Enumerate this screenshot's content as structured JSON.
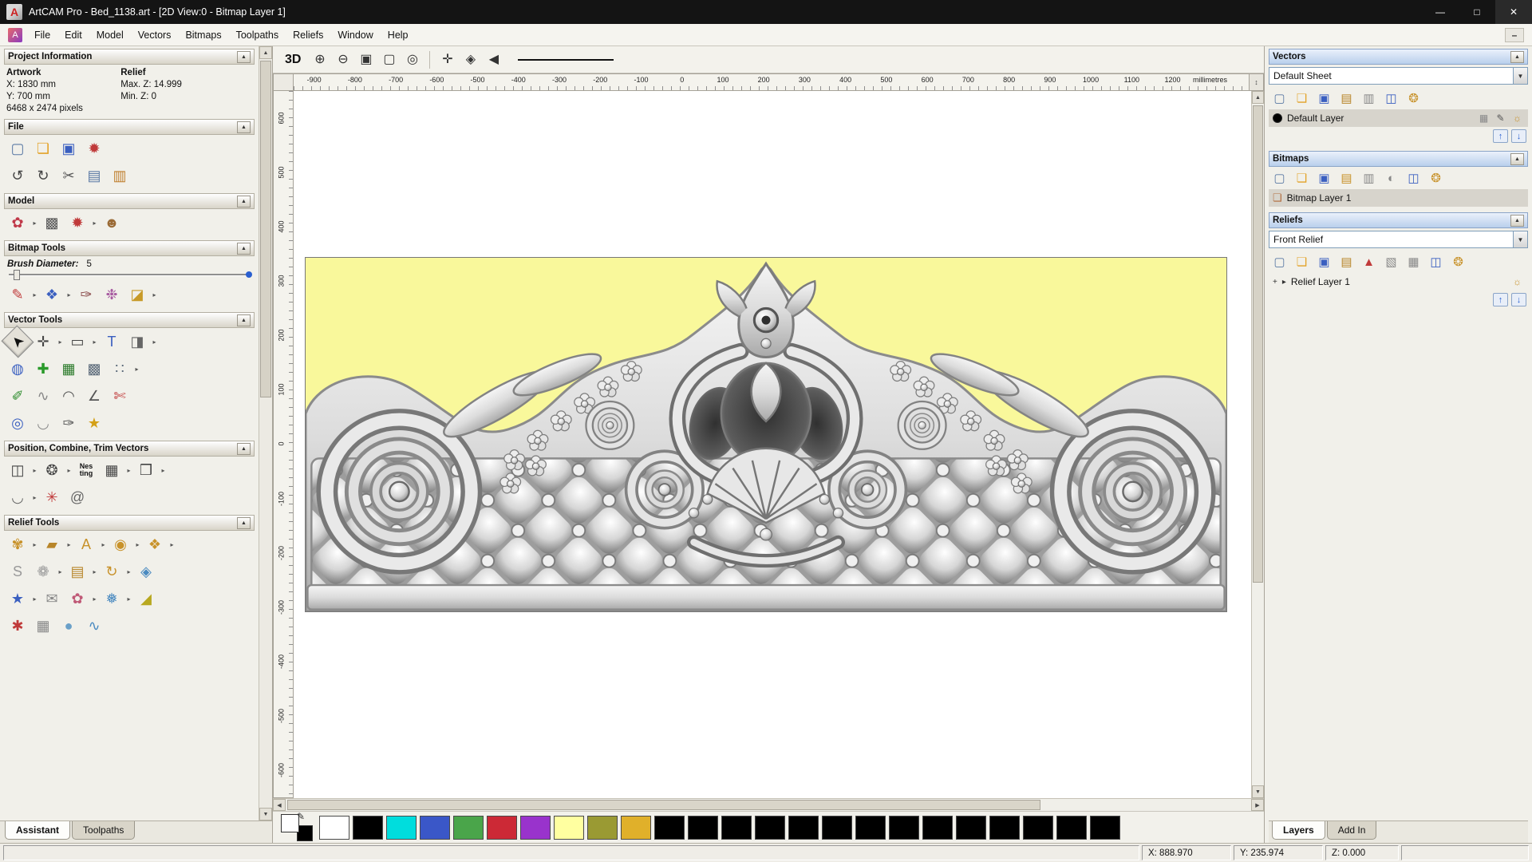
{
  "window": {
    "title": "ArtCAM Pro - Bed_1138.art - [2D View:0 - Bitmap Layer 1]",
    "logo_glyph": "A",
    "controls": {
      "minimize": "—",
      "maximize": "□",
      "close": "✕"
    }
  },
  "menu": {
    "items": [
      "File",
      "Edit",
      "Model",
      "Vectors",
      "Bitmaps",
      "Toolpaths",
      "Reliefs",
      "Window",
      "Help"
    ],
    "mdi_minimize": "–"
  },
  "ui": {
    "collapse": "▲",
    "dropdown": "▼",
    "arrow": "▸",
    "expander": "▸",
    "plus": "+",
    "up": "↑",
    "down": "↓",
    "scroll_up": "▲",
    "scroll_down": "▼",
    "scroll_left": "◀",
    "scroll_right": "▶",
    "resize": "↕",
    "pencil": "✎"
  },
  "left_panel": {
    "project_info": {
      "title": "Project Information",
      "artwork_label": "Artwork",
      "relief_label": "Relief",
      "x": "X: 1830 mm",
      "y": "Y: 700 mm",
      "pixels": "6468 x 2474 pixels",
      "max_z": "Max. Z: 14.999",
      "min_z": "Min. Z: 0"
    },
    "file": {
      "title": "File",
      "rows": [
        [
          {
            "n": "new-model-icon",
            "g": "▢",
            "c": "#5b7aa5"
          },
          {
            "n": "open-model-icon",
            "g": "❏",
            "c": "#e3a32a"
          },
          {
            "n": "save-model-icon",
            "g": "▣",
            "c": "#3a5fc0"
          },
          {
            "n": "model-notes-icon",
            "g": "✹",
            "c": "#c03a3a"
          }
        ],
        [
          {
            "n": "undo-icon",
            "g": "↺",
            "c": "#444444"
          },
          {
            "n": "redo-icon",
            "g": "↻",
            "c": "#444444"
          },
          {
            "n": "cut-icon",
            "g": "✂",
            "c": "#555555"
          },
          {
            "n": "copy-icon",
            "g": "▤",
            "c": "#5b7aa5"
          },
          {
            "n": "paste-icon",
            "g": "▥",
            "c": "#c08030"
          }
        ]
      ]
    },
    "model": {
      "title": "Model",
      "rows": [
        [
          {
            "n": "relief-wizard-icon",
            "g": "✿",
            "c": "#c03a4a",
            "a": true
          },
          {
            "n": "greyscale-icon",
            "g": "▩",
            "c": "#555555"
          },
          {
            "n": "lighting-icon",
            "g": "✹",
            "c": "#c03a3a",
            "a": true
          },
          {
            "n": "face-wizard-icon",
            "g": "☻",
            "c": "#9a6a35"
          }
        ]
      ]
    },
    "bitmap_tools": {
      "title": "Bitmap Tools",
      "brush_label": "Brush Diameter:",
      "brush_value": "5",
      "rows": [
        [
          {
            "n": "paint-brush-icon",
            "g": "✎",
            "c": "#c03a3a",
            "a": true
          },
          {
            "n": "paint-selective-icon",
            "g": "❖",
            "c": "#3a5fc0",
            "a": true
          },
          {
            "n": "colour-picker-icon",
            "g": "✑",
            "c": "#8a4a4a"
          },
          {
            "n": "palette-icon",
            "g": "❉",
            "c": "#a75aa0"
          },
          {
            "n": "flood-fill-icon",
            "g": "◪",
            "c": "#c89a28",
            "a": true
          }
        ]
      ]
    },
    "vector_tools": {
      "title": "Vector Tools",
      "rows": [
        [
          {
            "n": "select-vectors-icon",
            "g": "➤",
            "c": "#111111",
            "rot": -135,
            "p": true
          },
          {
            "n": "transform-vectors-icon",
            "g": "✛",
            "c": "#444444",
            "a": true
          },
          {
            "n": "create-rectangle-icon",
            "g": "▭",
            "c": "#444444",
            "a": true
          },
          {
            "n": "create-text-icon",
            "g": "T",
            "c": "#3a5fc0"
          },
          {
            "n": "mirror-vectors-icon",
            "g": "◨",
            "c": "#666666",
            "a": true
          }
        ],
        [
          {
            "n": "offset-vectors-icon",
            "g": "◍",
            "c": "#3a5fc0"
          },
          {
            "n": "vector-doctor-icon",
            "g": "✚",
            "c": "#2a9a2a"
          },
          {
            "n": "text-in-box-icon",
            "g": "▦",
            "c": "#2a7a2a"
          },
          {
            "n": "bitmap-to-vector-icon",
            "g": "▩",
            "c": "#5b6a7a"
          },
          {
            "n": "paste-along-curve-icon",
            "g": "∷",
            "c": "#5b6a7a",
            "a": true
          }
        ],
        [
          {
            "n": "create-polyline-icon",
            "g": "✐",
            "c": "#2a8a2a"
          },
          {
            "n": "free-smooth-icon",
            "g": "∿",
            "c": "#888888"
          },
          {
            "n": "node-editing-icon",
            "g": "◠",
            "c": "#555555"
          },
          {
            "n": "measure-icon",
            "g": "∠",
            "c": "#555555"
          },
          {
            "n": "trim-vectors-icon",
            "g": "✄",
            "c": "#c03a3a"
          }
        ],
        [
          {
            "n": "join-vectors-icon",
            "g": "◎",
            "c": "#3a5fc0"
          },
          {
            "n": "fillet-arc-icon",
            "g": "◡",
            "c": "#888888"
          },
          {
            "n": "vector-pen-icon",
            "g": "✑",
            "c": "#555555"
          },
          {
            "n": "create-star-icon",
            "g": "★",
            "c": "#d4a017"
          }
        ]
      ]
    },
    "position_tools": {
      "title": "Position, Combine, Trim Vectors",
      "rows": [
        [
          {
            "n": "align-vectors-icon",
            "g": "◫",
            "c": "#444444",
            "a": true
          },
          {
            "n": "circular-copy-icon",
            "g": "❂",
            "c": "#444444",
            "a": true
          },
          {
            "n": "nesting-icon",
            "g": "Nes\nting",
            "c": "#111111"
          },
          {
            "n": "block-copy-icon",
            "g": "▦",
            "c": "#444444",
            "a": true
          },
          {
            "n": "group-vectors-icon",
            "g": "❒",
            "c": "#444444",
            "a": true
          }
        ],
        [
          {
            "n": "wrap-vectors-icon",
            "g": "◡",
            "c": "#666666",
            "a": true
          },
          {
            "n": "weld-vectors-icon",
            "g": "✳",
            "c": "#c03a3a"
          },
          {
            "n": "create-spiral-icon",
            "g": "@",
            "c": "#666666"
          }
        ]
      ]
    },
    "relief_tools": {
      "title": "Relief Tools",
      "rows": [
        [
          {
            "n": "sculpting-icon",
            "g": "✾",
            "c": "#c8922a",
            "a": true
          },
          {
            "n": "smooth-relief-icon",
            "g": "▰",
            "c": "#b8862a",
            "a": true
          },
          {
            "n": "relief-text-icon",
            "g": "A",
            "c": "#c8922a",
            "a": true
          },
          {
            "n": "shape-editor-icon",
            "g": "◉",
            "c": "#c8922a",
            "a": true
          },
          {
            "n": "extrude-relief-icon",
            "g": "❖",
            "c": "#c8922a",
            "a": true
          }
        ],
        [
          {
            "n": "two-rail-sweep-icon",
            "g": "S",
            "c": "#999999"
          },
          {
            "n": "weave-wizard-icon",
            "g": "❁",
            "c": "#999999",
            "a": true
          },
          {
            "n": "relief-library-icon",
            "g": "▤",
            "c": "#b8862a",
            "a": true
          },
          {
            "n": "spin-relief-icon",
            "g": "↻",
            "c": "#c8922a",
            "a": true
          },
          {
            "n": "constrain-relief-icon",
            "g": "◈",
            "c": "#4a8ac0"
          }
        ],
        [
          {
            "n": "star-relief-icon",
            "g": "★",
            "c": "#3a5fc0",
            "a": true
          },
          {
            "n": "relief-envelope-icon",
            "g": "✉",
            "c": "#888888"
          },
          {
            "n": "fan-relief-icon",
            "g": "✿",
            "c": "#c05a77",
            "a": true
          },
          {
            "n": "texture-relief-icon",
            "g": "❅",
            "c": "#4a8ac0",
            "a": true
          },
          {
            "n": "angled-plane-icon",
            "g": "◢",
            "c": "#b8a820"
          }
        ],
        [
          {
            "n": "offset-relief-icon",
            "g": "✱",
            "c": "#c03a3a"
          },
          {
            "n": "mesh-relief-icon",
            "g": "▦",
            "c": "#888888"
          },
          {
            "n": "dome-relief-icon",
            "g": "●",
            "c": "#6aa0c8"
          },
          {
            "n": "wave-relief-icon",
            "g": "∿",
            "c": "#4a8ac0"
          }
        ]
      ]
    },
    "tabs": [
      {
        "label": "Assistant",
        "active": true
      },
      {
        "label": "Toolpaths",
        "active": false
      }
    ]
  },
  "canvas": {
    "view_3d_label": "3D",
    "zoom_tools": [
      [
        {
          "n": "zoom-in-icon",
          "g": "⊕",
          "c": "#333333"
        },
        {
          "n": "zoom-out-icon",
          "g": "⊖",
          "c": "#333333"
        },
        {
          "n": "zoom-window-icon",
          "g": "▣",
          "c": "#333333"
        },
        {
          "n": "zoom-fit-icon",
          "g": "▢",
          "c": "#333333"
        },
        {
          "n": "zoom-objects-icon",
          "g": "◎",
          "c": "#333333"
        }
      ]
    ],
    "nav_tools": [
      [
        {
          "n": "pan-view-icon",
          "g": "✛",
          "c": "#333333"
        },
        {
          "n": "centre-view-icon",
          "g": "◈",
          "c": "#333333"
        },
        {
          "n": "previous-view-icon",
          "g": "◀",
          "c": "#333333"
        }
      ]
    ],
    "ruler_unit": "millimetres",
    "h_ticks": [
      "-900",
      "-800",
      "-700",
      "-600",
      "-500",
      "-400",
      "-300",
      "-200",
      "-100",
      "0",
      "100",
      "200",
      "300",
      "400",
      "500",
      "600",
      "700",
      "800",
      "900",
      "1000",
      "1100",
      "1200"
    ],
    "v_ticks": [
      "600",
      "500",
      "400",
      "300",
      "200",
      "100",
      "0",
      "-100",
      "-200",
      "-300",
      "-400",
      "-500",
      "-600"
    ],
    "artwork_bg": "#f9f89b"
  },
  "palette": {
    "selector": {
      "front": "#ffffff",
      "back": "#000000"
    },
    "swatches": [
      "#ffffff",
      "#000000",
      "#00dddd",
      "#3a57c8",
      "#4aa54a",
      "#cc2936",
      "#9933cc",
      "#ffffa0",
      "#9a9a33",
      "#e0b02a",
      "#000000",
      "#000000",
      "#000000",
      "#000000",
      "#000000",
      "#000000",
      "#000000",
      "#000000",
      "#000000",
      "#000000",
      "#000000",
      "#000000",
      "#000000",
      "#000000"
    ]
  },
  "right_panel": {
    "vectors": {
      "title": "Vectors",
      "sheet": "Default Sheet",
      "toolbar": [
        [
          {
            "n": "new-sheet-icon",
            "g": "▢",
            "c": "#5b7aa5"
          },
          {
            "n": "open-sheet-icon",
            "g": "❏",
            "c": "#e3a32a"
          },
          {
            "n": "save-sheet-icon",
            "g": "▣",
            "c": "#3a5fc0"
          },
          {
            "n": "import-vectors-icon",
            "g": "▤",
            "c": "#b8862a"
          },
          {
            "n": "export-vectors-icon",
            "g": "▥",
            "c": "#888888"
          },
          {
            "n": "delete-layer-icon",
            "g": "◫",
            "c": "#3a5fc0"
          },
          {
            "n": "layer-wizard-icon",
            "g": "❂",
            "c": "#c8922a"
          }
        ]
      ],
      "layer": {
        "name": "Default Layer",
        "swatch": "#000000",
        "icons": [
          [
            {
              "n": "layer-lock-icon",
              "g": "▦",
              "c": "#888888"
            },
            {
              "n": "layer-edit-icon",
              "g": "✎",
              "c": "#555555"
            },
            {
              "n": "layer-visible-icon",
              "g": "☼",
              "c": "#c8922a"
            }
          ]
        ]
      }
    },
    "bitmaps": {
      "title": "Bitmaps",
      "toolbar": [
        [
          {
            "n": "new-bitmap-layer-icon",
            "g": "▢",
            "c": "#5b7aa5"
          },
          {
            "n": "open-bitmap-layer-icon",
            "g": "❏",
            "c": "#e3a32a"
          },
          {
            "n": "save-bitmap-layer-icon",
            "g": "▣",
            "c": "#3a5fc0"
          },
          {
            "n": "copy-bitmap-layer-icon",
            "g": "▤",
            "c": "#c8922a"
          },
          {
            "n": "merge-bitmap-layers-icon",
            "g": "▥",
            "c": "#888888"
          },
          {
            "n": "preview-bitmap-icon",
            "g": "◐",
            "c": "#888888"
          },
          {
            "n": "delete-bitmap-layer-icon",
            "g": "◫",
            "c": "#3a5fc0"
          },
          {
            "n": "bitmap-wizard-icon",
            "g": "❂",
            "c": "#c8922a"
          }
        ]
      ],
      "layer": {
        "name": "Bitmap Layer 1",
        "glyph": "❏"
      }
    },
    "reliefs": {
      "title": "Reliefs",
      "pick": "Front Relief",
      "toolbar": [
        [
          {
            "n": "new-relief-layer-icon",
            "g": "▢",
            "c": "#5b7aa5"
          },
          {
            "n": "open-relief-layer-icon",
            "g": "❏",
            "c": "#e3a32a"
          },
          {
            "n": "save-relief-layer-icon",
            "g": "▣",
            "c": "#3a5fc0"
          },
          {
            "n": "copy-relief-layer-icon",
            "g": "▤",
            "c": "#b8862a"
          },
          {
            "n": "pyramid-icon",
            "g": "▲",
            "c": "#c03a3a"
          },
          {
            "n": "sheet-relief-icon",
            "g": "▧",
            "c": "#888888"
          },
          {
            "n": "calculate-relief-icon",
            "g": "▦",
            "c": "#888888"
          },
          {
            "n": "delete-relief-layer-icon",
            "g": "◫",
            "c": "#3a5fc0"
          },
          {
            "n": "relief-wizard2-icon",
            "g": "❂",
            "c": "#c8922a"
          }
        ]
      ],
      "layer": {
        "name": "Relief Layer 1"
      }
    },
    "tabs": [
      {
        "label": "Layers",
        "active": true
      },
      {
        "label": "Add In",
        "active": false
      }
    ]
  },
  "status_bar": {
    "x": "X: 888.970",
    "y": "Y: 235.974",
    "z": "Z: 0.000"
  }
}
